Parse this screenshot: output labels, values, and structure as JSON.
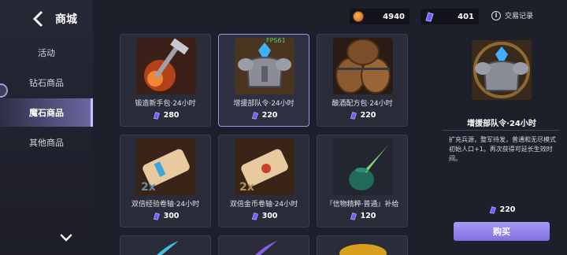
{
  "header": {
    "title": "商城",
    "gold_amount": "4940",
    "gem_amount": "401",
    "trade_log_label": "交易记录"
  },
  "sidebar": {
    "items": [
      {
        "label": "活动"
      },
      {
        "label": "钻石商品"
      },
      {
        "label": "魔石商品",
        "active": true
      },
      {
        "label": "其他商品"
      }
    ]
  },
  "grid": {
    "items": [
      {
        "name": "锻造新手包·24小时",
        "price": "280",
        "icon": "forge-hammer-icon"
      },
      {
        "name": "增援部队令·24小时",
        "price": "220",
        "icon": "armor-knight-icon",
        "selected": true
      },
      {
        "name": "酿酒配方包·24小时",
        "price": "220",
        "icon": "barrel-icon"
      },
      {
        "name": "双倍经验卷轴·24小时",
        "price": "300",
        "icon": "scroll-icon"
      },
      {
        "name": "双倍金币卷轴·24小时",
        "price": "300",
        "icon": "scroll-icon"
      },
      {
        "name": "『信物精粹·普通』补给",
        "price": "120",
        "icon": "feather-ink-icon"
      }
    ],
    "fps_label": "FPS61"
  },
  "detail": {
    "title": "增援部队令·24小时",
    "description": "扩充兵源，整军待发，普通和无尽模式初始人口+1。再次获得可延长生效时间。",
    "price": "220",
    "buy_label": "购买"
  },
  "colors": {
    "background": "#1d1f2b",
    "accent": "#9b94f0",
    "gem": "#6a5cff",
    "gold": "#ffb24d"
  }
}
